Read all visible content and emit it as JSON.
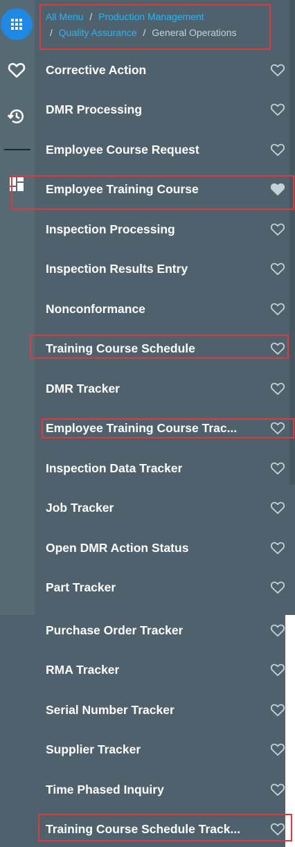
{
  "breadcrumb": {
    "links": [
      "All Menu",
      "Production Management",
      "Quality Assurance"
    ],
    "current": "General Operations",
    "separator": "/"
  },
  "rail": {
    "icons": [
      "apps-grid-icon",
      "heart-icon",
      "history-icon",
      "dashboard-icon"
    ]
  },
  "menu": {
    "items": [
      {
        "label": "Corrective Action",
        "favorite": false
      },
      {
        "label": "DMR Processing",
        "favorite": false
      },
      {
        "label": "Employee Course Request",
        "favorite": false
      },
      {
        "label": "Employee Training Course",
        "favorite": true
      },
      {
        "label": "Inspection Processing",
        "favorite": false
      },
      {
        "label": "Inspection Results Entry",
        "favorite": false
      },
      {
        "label": "Nonconformance",
        "favorite": false
      },
      {
        "label": "Training Course Schedule",
        "favorite": false
      },
      {
        "label": "DMR Tracker",
        "favorite": false
      },
      {
        "label": "Employee Training Course Trac...",
        "favorite": false
      },
      {
        "label": "Inspection Data Tracker",
        "favorite": false
      },
      {
        "label": "Job Tracker",
        "favorite": false
      },
      {
        "label": "Open DMR Action Status",
        "favorite": false
      },
      {
        "label": "Part Tracker",
        "favorite": false
      },
      {
        "label": "Purchase Order Tracker",
        "favorite": false
      },
      {
        "label": "RMA Tracker",
        "favorite": false
      },
      {
        "label": "Serial Number Tracker",
        "favorite": false
      },
      {
        "label": "Supplier Tracker",
        "favorite": false
      },
      {
        "label": "Time Phased Inquiry",
        "favorite": false
      },
      {
        "label": "Training Course Schedule Track...",
        "favorite": false
      }
    ]
  },
  "colors": {
    "panel": "#4e616c",
    "rail": "#566a74",
    "accent": "#1e88e5",
    "link": "#29b6f6",
    "highlight": "#e0383e"
  }
}
